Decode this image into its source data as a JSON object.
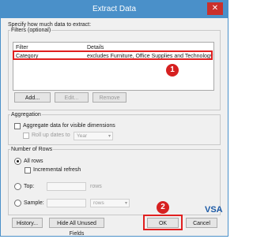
{
  "window": {
    "title": "Extract Data",
    "close_glyph": "✕"
  },
  "instructions": "Specify how much data to extract:",
  "filters": {
    "group_title": "Filters (optional)",
    "columns": [
      "Filter",
      "Details"
    ],
    "rows": [
      {
        "filter": "Category",
        "details": "excludes Furniture, Office Supplies and Technology"
      }
    ],
    "buttons": {
      "add": "Add...",
      "edit": "Edit...",
      "remove": "Remove"
    }
  },
  "aggregation": {
    "group_title": "Aggregation",
    "aggregate_label": "Aggregate data for visible dimensions",
    "rollup_label": "Roll up dates to",
    "rollup_value": "Year"
  },
  "number_of_rows": {
    "group_title": "Number of Rows",
    "all_rows": "All rows",
    "incremental": "Incremental refresh",
    "top": "Top:",
    "top_unit": "rows",
    "sample": "Sample:",
    "sample_unit": "rows"
  },
  "footer": {
    "history": "History...",
    "hide_unused": "Hide All Unused Fields",
    "ok": "OK",
    "cancel": "Cancel"
  },
  "annotations": {
    "badge1": "1",
    "badge2": "2"
  },
  "watermark": "VSA"
}
